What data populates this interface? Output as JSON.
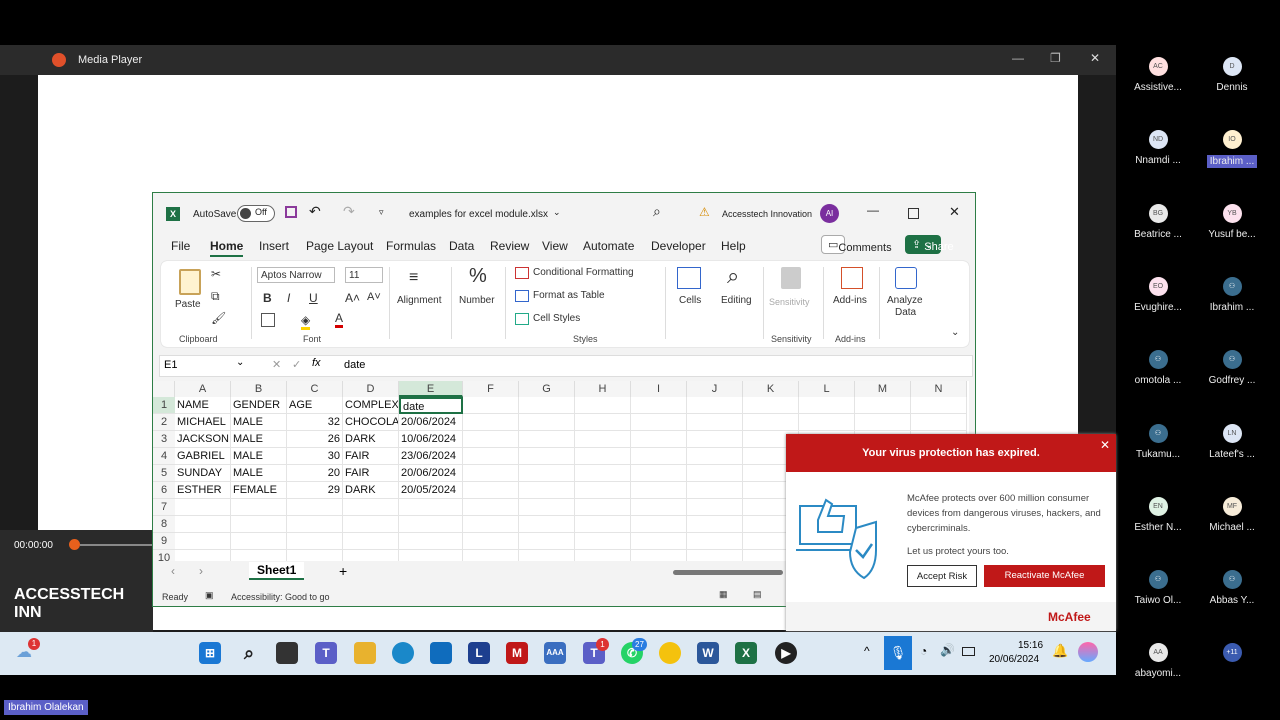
{
  "media_player": {
    "title": "Media Player",
    "time": "00:00:00",
    "overlay_text": "ACCESSTECH INN"
  },
  "excel": {
    "autosave_label": "AutoSave",
    "autosave_state": "Off",
    "filename": "examples for excel module.xlsx",
    "account": "Accesstech Innovation",
    "account_initials": "AI",
    "tabs": [
      "File",
      "Home",
      "Insert",
      "Page Layout",
      "Formulas",
      "Data",
      "Review",
      "View",
      "Automate",
      "Developer",
      "Help"
    ],
    "comments_label": "Comments",
    "share_label": "Share",
    "ribbon": {
      "paste": "Paste",
      "clipboard": "Clipboard",
      "font_name": "Aptos Narrow",
      "font_size": "11",
      "font_group": "Font",
      "bold": "B",
      "italic": "I",
      "underline": "U",
      "alignment": "Alignment",
      "number": "Number",
      "cond_format": "Conditional Formatting",
      "format_table": "Format as Table",
      "cell_styles": "Cell Styles",
      "styles": "Styles",
      "cells": "Cells",
      "editing": "Editing",
      "sensitivity": "Sensitivity",
      "sensitivity_group": "Sensitivity",
      "addins": "Add-ins",
      "addins_group": "Add-ins",
      "analyze": "Analyze",
      "analyze2": "Data"
    },
    "name_box": "E1",
    "formula": "date",
    "columns": [
      "A",
      "B",
      "C",
      "D",
      "E",
      "F",
      "G",
      "H",
      "I",
      "J",
      "K",
      "L",
      "M",
      "N"
    ],
    "rows": [
      "1",
      "2",
      "3",
      "4",
      "5",
      "6",
      "7",
      "8",
      "9",
      "10"
    ],
    "data": [
      [
        "NAME",
        "GENDER",
        "AGE",
        "COMPLEXION",
        "date"
      ],
      [
        "MICHAEL",
        "MALE",
        "32",
        "CHOCOLATE",
        "20/06/2024"
      ],
      [
        "JACKSON",
        "MALE",
        "26",
        "DARK",
        "10/06/2024"
      ],
      [
        "GABRIEL",
        "MALE",
        "30",
        "FAIR",
        "23/06/2024"
      ],
      [
        "SUNDAY",
        "MALE",
        "20",
        "FAIR",
        "20/06/2024"
      ],
      [
        "ESTHER",
        "FEMALE",
        "29",
        "DARK",
        "20/05/2024"
      ]
    ],
    "sheet": "Sheet1",
    "status_ready": "Ready",
    "status_access": "Accessibility: Good to go"
  },
  "mcafee": {
    "header": "Your virus protection has expired.",
    "body": "McAfee protects over 600 million consumer devices from dangerous viruses, hackers, and cybercriminals.",
    "body2": "Let us protect yours too.",
    "accept": "Accept Risk",
    "reactivate": "Reactivate McAfee",
    "brand": "McAfee",
    "colors": {
      "red": "#c01818"
    }
  },
  "participants": [
    {
      "initials": "AC",
      "name": "Assistive..."
    },
    {
      "initials": "D",
      "name": "Dennis"
    },
    {
      "initials": "ND",
      "name": "Nnamdi ..."
    },
    {
      "initials": "IO",
      "name": "Ibrahim ..."
    },
    {
      "initials": "BG",
      "name": "Beatrice ..."
    },
    {
      "initials": "YB",
      "name": "Yusuf be..."
    },
    {
      "initials": "EO",
      "name": "Evughire..."
    },
    {
      "initials": "",
      "name": "Ibrahim ..."
    },
    {
      "initials": "",
      "name": "omotola ..."
    },
    {
      "initials": "",
      "name": "Godfrey ..."
    },
    {
      "initials": "",
      "name": "Tukamu..."
    },
    {
      "initials": "LN",
      "name": "Lateef's ..."
    },
    {
      "initials": "EN",
      "name": "Esther N..."
    },
    {
      "initials": "MF",
      "name": "Michael ..."
    },
    {
      "initials": "",
      "name": "Taiwo Ol..."
    },
    {
      "initials": "",
      "name": "Abbas Y..."
    },
    {
      "initials": "AA",
      "name": "abayomi..."
    },
    {
      "initials": "+11",
      "name": ""
    }
  ],
  "taskbar": {
    "time": "15:16",
    "date": "20/06/2024",
    "teams_badge": "1",
    "whatsapp_badge": "27",
    "notif_badge": "1"
  },
  "presenter": "Ibrahim Olalekan"
}
